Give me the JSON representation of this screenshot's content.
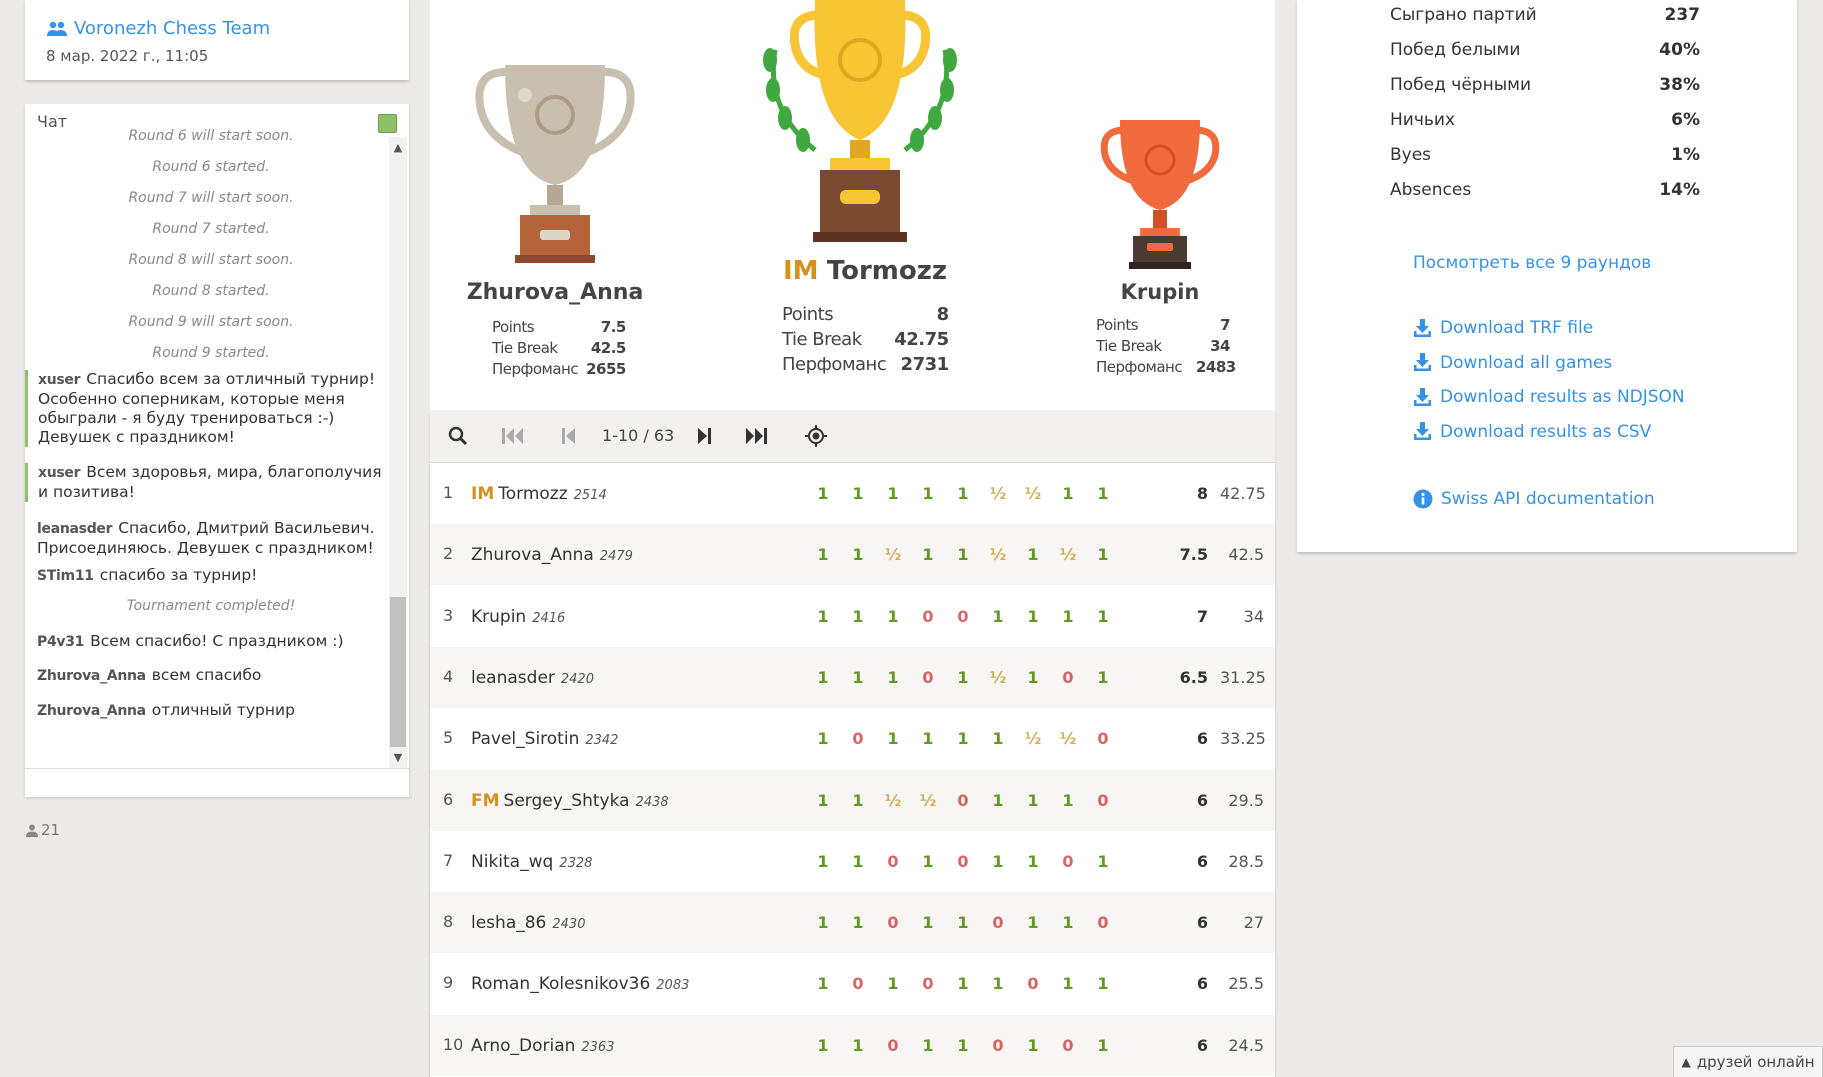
{
  "team": {
    "name": "Voronezh Chess Team",
    "date": "8 мар. 2022 г., 11:05"
  },
  "chat": {
    "title": "Чат",
    "messages": [
      {
        "kind": "sys",
        "text": "Round 6 will start soon."
      },
      {
        "kind": "sys",
        "text": "Round 6 started."
      },
      {
        "kind": "sys",
        "text": "Round 7 will start soon."
      },
      {
        "kind": "sys",
        "text": "Round 7 started."
      },
      {
        "kind": "sys",
        "text": "Round 8 will start soon."
      },
      {
        "kind": "sys",
        "text": "Round 8 started."
      },
      {
        "kind": "sys",
        "text": "Round 9 will start soon."
      },
      {
        "kind": "sys",
        "text": "Round 9 started."
      },
      {
        "kind": "user",
        "user": "xuser",
        "text": "Спасибо всем за отличный турнир! Особенно соперникам, которые меня обыграли - я буду тренироваться :-) Девушек с праздником!",
        "highlight": true
      },
      {
        "kind": "user",
        "user": "xuser",
        "text": "Всем здоровья, мира, благополучия и позитива!",
        "highlight": true
      },
      {
        "kind": "user",
        "user": "leanasder",
        "text": "Спасибо, Дмитрий Васильевич. Присоединяюсь. Девушек с праздником!"
      },
      {
        "kind": "user",
        "user": "STim11",
        "text": "спасибо за турнир!"
      },
      {
        "kind": "sys",
        "text": "Tournament completed!"
      },
      {
        "kind": "user",
        "user": "P4v31",
        "text": "Всем спасибо! С праздником :)"
      },
      {
        "kind": "user",
        "user": "Zhurova_Anna",
        "text": "всем спасибо"
      },
      {
        "kind": "user",
        "user": "Zhurova_Anna",
        "text": "отличный турнир"
      }
    ]
  },
  "watchers": "21",
  "podium": {
    "first": {
      "title": "IM",
      "name": "Tormozz",
      "points": "8",
      "tiebreak": "42.75",
      "performance": "2731"
    },
    "second": {
      "title": "",
      "name": "Zhurova_Anna",
      "points": "7.5",
      "tiebreak": "42.5",
      "performance": "2655"
    },
    "third": {
      "title": "",
      "name": "Krupin",
      "points": "7",
      "tiebreak": "34",
      "performance": "2483"
    },
    "labels": {
      "points": "Points",
      "tiebreak": "Tie Break",
      "performance": "Перфоманс"
    }
  },
  "pager": {
    "range": "1-10 / 63"
  },
  "standings": [
    {
      "rank": "1",
      "title": "IM",
      "name": "Tormozz",
      "rating": "2514",
      "results": [
        "1",
        "1",
        "1",
        "1",
        "1",
        "½",
        "½",
        "1",
        "1"
      ],
      "points": "8",
      "tb": "42.75"
    },
    {
      "rank": "2",
      "title": "",
      "name": "Zhurova_Anna",
      "rating": "2479",
      "results": [
        "1",
        "1",
        "½",
        "1",
        "1",
        "½",
        "1",
        "½",
        "1"
      ],
      "points": "7.5",
      "tb": "42.5"
    },
    {
      "rank": "3",
      "title": "",
      "name": "Krupin",
      "rating": "2416",
      "results": [
        "1",
        "1",
        "1",
        "0",
        "0",
        "1",
        "1",
        "1",
        "1"
      ],
      "points": "7",
      "tb": "34"
    },
    {
      "rank": "4",
      "title": "",
      "name": "leanasder",
      "rating": "2420",
      "results": [
        "1",
        "1",
        "1",
        "0",
        "1",
        "½",
        "1",
        "0",
        "1"
      ],
      "points": "6.5",
      "tb": "31.25"
    },
    {
      "rank": "5",
      "title": "",
      "name": "Pavel_Sirotin",
      "rating": "2342",
      "results": [
        "1",
        "0",
        "1",
        "1",
        "1",
        "1",
        "½",
        "½",
        "0"
      ],
      "points": "6",
      "tb": "33.25"
    },
    {
      "rank": "6",
      "title": "FM",
      "name": "Sergey_Shtyka",
      "rating": "2438",
      "results": [
        "1",
        "1",
        "½",
        "½",
        "0",
        "1",
        "1",
        "1",
        "0"
      ],
      "points": "6",
      "tb": "29.5"
    },
    {
      "rank": "7",
      "title": "",
      "name": "Nikita_wq",
      "rating": "2328",
      "results": [
        "1",
        "1",
        "0",
        "1",
        "0",
        "1",
        "1",
        "0",
        "1"
      ],
      "points": "6",
      "tb": "28.5"
    },
    {
      "rank": "8",
      "title": "",
      "name": "lesha_86",
      "rating": "2430",
      "results": [
        "1",
        "1",
        "0",
        "1",
        "1",
        "0",
        "1",
        "1",
        "0"
      ],
      "points": "6",
      "tb": "27"
    },
    {
      "rank": "9",
      "title": "",
      "name": "Roman_Kolesnikov36",
      "rating": "2083",
      "results": [
        "1",
        "0",
        "1",
        "0",
        "1",
        "1",
        "0",
        "1",
        "1"
      ],
      "points": "6",
      "tb": "25.5"
    },
    {
      "rank": "10",
      "title": "",
      "name": "Arno_Dorian",
      "rating": "2363",
      "results": [
        "1",
        "1",
        "0",
        "1",
        "1",
        "0",
        "1",
        "0",
        "1"
      ],
      "points": "6",
      "tb": "24.5"
    }
  ],
  "stats": [
    {
      "label": "Сыграно партий",
      "value": "237"
    },
    {
      "label": "Побед белыми",
      "value": "40%"
    },
    {
      "label": "Побед чёрными",
      "value": "38%"
    },
    {
      "label": "Ничьих",
      "value": "6%"
    },
    {
      "label": "Byes",
      "value": "1%"
    },
    {
      "label": "Absences",
      "value": "14%"
    }
  ],
  "links": {
    "rounds": "Посмотреть все 9 раундов",
    "downloads": [
      "Download TRF file",
      "Download all games",
      "Download results as NDJSON",
      "Download results as CSV"
    ],
    "api": "Swiss API documentation"
  },
  "friends": "друзей онлайн",
  "colors": {
    "link": "#3692e7",
    "win": "#629924",
    "loss": "#cc3333",
    "draw": "#c79b26",
    "title": "#d59120",
    "gold": "#f8c534",
    "silver": "#c9bfae",
    "bronze": "#f06a3d"
  }
}
